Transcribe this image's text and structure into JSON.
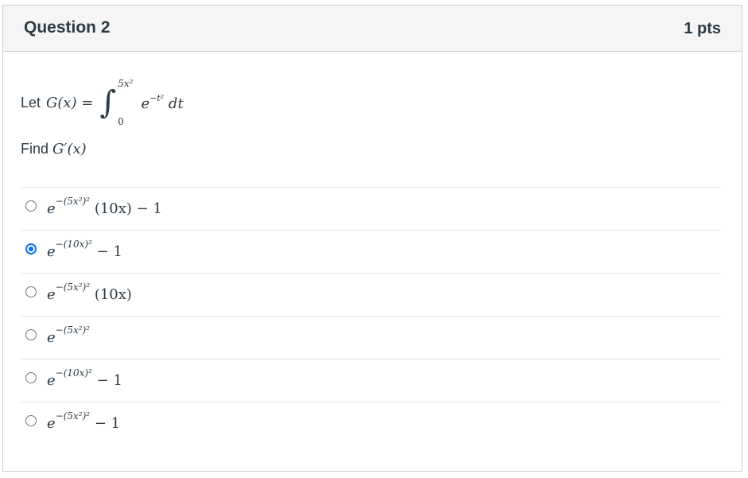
{
  "question": {
    "title": "Question 2",
    "points": "1 pts"
  },
  "stem": {
    "let_word": "Let",
    "lhs": "G(x) =",
    "integral_symbol": "∫",
    "upper_limit": "5x²",
    "lower_limit": "0",
    "integrand_base": "e",
    "integrand_exp": "−t²",
    "integrand_diff": "dt",
    "find_word": "Find",
    "find_expr": "G′(x)"
  },
  "answers": [
    {
      "base": "e",
      "exp": "−(5x²)²",
      "rest": " (10x) − 1",
      "selected": false
    },
    {
      "base": "e",
      "exp": "−(10x)²",
      "rest": " − 1",
      "selected": true
    },
    {
      "base": "e",
      "exp": "−(5x²)²",
      "rest": " (10x)",
      "selected": false
    },
    {
      "base": "e",
      "exp": "−(5x²)²",
      "rest": "",
      "selected": false
    },
    {
      "base": "e",
      "exp": "−(10x)²",
      "rest": " − 1",
      "selected": false
    },
    {
      "base": "e",
      "exp": "−(5x²)²",
      "rest": " − 1",
      "selected": false
    }
  ],
  "colors": {
    "accent": "#0b6ef2",
    "header_bg": "#f5f5f5",
    "border": "#c7cdd1"
  }
}
